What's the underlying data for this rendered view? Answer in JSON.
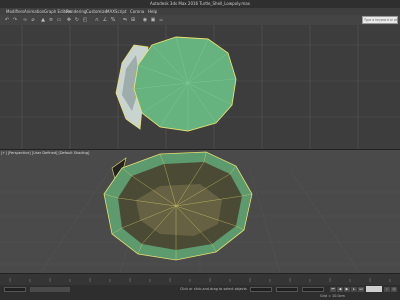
{
  "window": {
    "title": "Autodesk 3ds Max 2016   Turtle_Shell_Lowpoly.max"
  },
  "menubar": {
    "items": [
      "Modifiers",
      "Animation",
      "Graph Editors",
      "Rendering",
      "Customize",
      "MAXScript",
      "Corona",
      "Help"
    ]
  },
  "toolbar": {
    "search_placeholder": "Type a keyword or phrase"
  },
  "viewports": {
    "bottom_label": "[+] [Perspective] [User Defined] [Default Shading]"
  },
  "statusbar": {
    "message": "Click or click-and-drag to select objects",
    "grid_label": "Grid = 10.0cm"
  },
  "colors": {
    "shell_green": "#5fb17a",
    "wire_yellow": "#e8e070",
    "grid_line": "#505050",
    "viewport_bg": "#3d3d3d"
  }
}
